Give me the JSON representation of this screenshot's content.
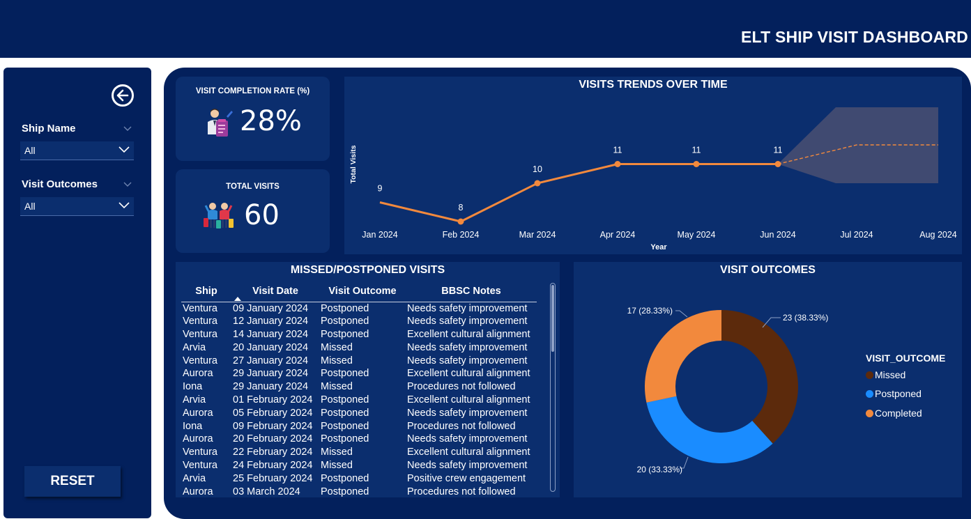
{
  "header": {
    "title": "ELT SHIP VISIT DASHBOARD"
  },
  "filters": {
    "ship_name": {
      "label": "Ship Name",
      "value": "All"
    },
    "visit_outcomes": {
      "label": "Visit Outcomes",
      "value": "All"
    },
    "reset_label": "RESET"
  },
  "kpis": {
    "completion": {
      "title": "VISIT COMPLETION RATE (%)",
      "value": "28%"
    },
    "total": {
      "title": "TOTAL VISITS",
      "value": "60"
    }
  },
  "trend": {
    "title": "VISITS TRENDS OVER TIME",
    "xlabel": "Year",
    "ylabel": "Total Visits"
  },
  "table": {
    "title": "MISSED/POSTPONED VISITS",
    "columns": [
      "Ship",
      "Visit Date",
      "Visit Outcome",
      "BBSC Notes"
    ],
    "rows": [
      [
        "Ventura",
        "09 January 2024",
        "Postponed",
        "Needs safety improvement"
      ],
      [
        "Ventura",
        "12 January 2024",
        "Postponed",
        "Needs safety improvement"
      ],
      [
        "Ventura",
        "14 January 2024",
        "Postponed",
        "Excellent cultural alignment"
      ],
      [
        "Arvia",
        "20 January 2024",
        "Missed",
        "Needs safety improvement"
      ],
      [
        "Ventura",
        "27 January 2024",
        "Missed",
        "Needs safety improvement"
      ],
      [
        "Aurora",
        "29 January 2024",
        "Postponed",
        "Excellent cultural alignment"
      ],
      [
        "Iona",
        "29 January 2024",
        "Missed",
        "Procedures not followed"
      ],
      [
        "Arvia",
        "01 February 2024",
        "Postponed",
        "Excellent cultural alignment"
      ],
      [
        "Aurora",
        "05 February 2024",
        "Postponed",
        "Needs safety improvement"
      ],
      [
        "Iona",
        "09 February 2024",
        "Postponed",
        "Procedures not followed"
      ],
      [
        "Aurora",
        "20 February 2024",
        "Postponed",
        "Needs safety improvement"
      ],
      [
        "Ventura",
        "22 February 2024",
        "Missed",
        "Excellent cultural alignment"
      ],
      [
        "Ventura",
        "24 February 2024",
        "Missed",
        "Needs safety improvement"
      ],
      [
        "Arvia",
        "25 February 2024",
        "Postponed",
        "Positive crew engagement"
      ],
      [
        "Aurora",
        "03 March 2024",
        "Postponed",
        "Procedures not followed"
      ]
    ]
  },
  "outcomes": {
    "title": "VISIT OUTCOMES",
    "legend_title": "VISIT_OUTCOME"
  },
  "colors": {
    "missed": "#5c2a0c",
    "postponed": "#1a8cff",
    "completed": "#f2893d",
    "line": "#f2893d",
    "background": "#03205c",
    "panel": "#0b2e6e"
  },
  "chart_data": [
    {
      "type": "line",
      "title": "VISITS TRENDS OVER TIME",
      "xlabel": "Year",
      "ylabel": "Total Visits",
      "categories": [
        "Jan 2024",
        "Feb 2024",
        "Mar 2024",
        "Apr 2024",
        "May 2024",
        "Jun 2024",
        "Jul 2024",
        "Aug 2024"
      ],
      "values": [
        9,
        8,
        10,
        11,
        11,
        11
      ],
      "labels": [
        "9",
        "8",
        "10",
        "11",
        "11",
        "11"
      ],
      "forecast": {
        "from": "Jun 2024",
        "to": "Aug 2024",
        "values": [
          11,
          12,
          12
        ],
        "shaded_band": true
      },
      "grid": false
    },
    {
      "type": "pie",
      "title": "VISIT OUTCOMES",
      "donut": true,
      "legend_title": "VISIT_OUTCOME",
      "legend_position": "right",
      "categories": [
        "Missed",
        "Postponed",
        "Completed"
      ],
      "values": [
        23,
        20,
        17
      ],
      "labels": [
        "23 (38.33%)",
        "20 (33.33%)",
        "17 (28.33%)"
      ]
    }
  ]
}
